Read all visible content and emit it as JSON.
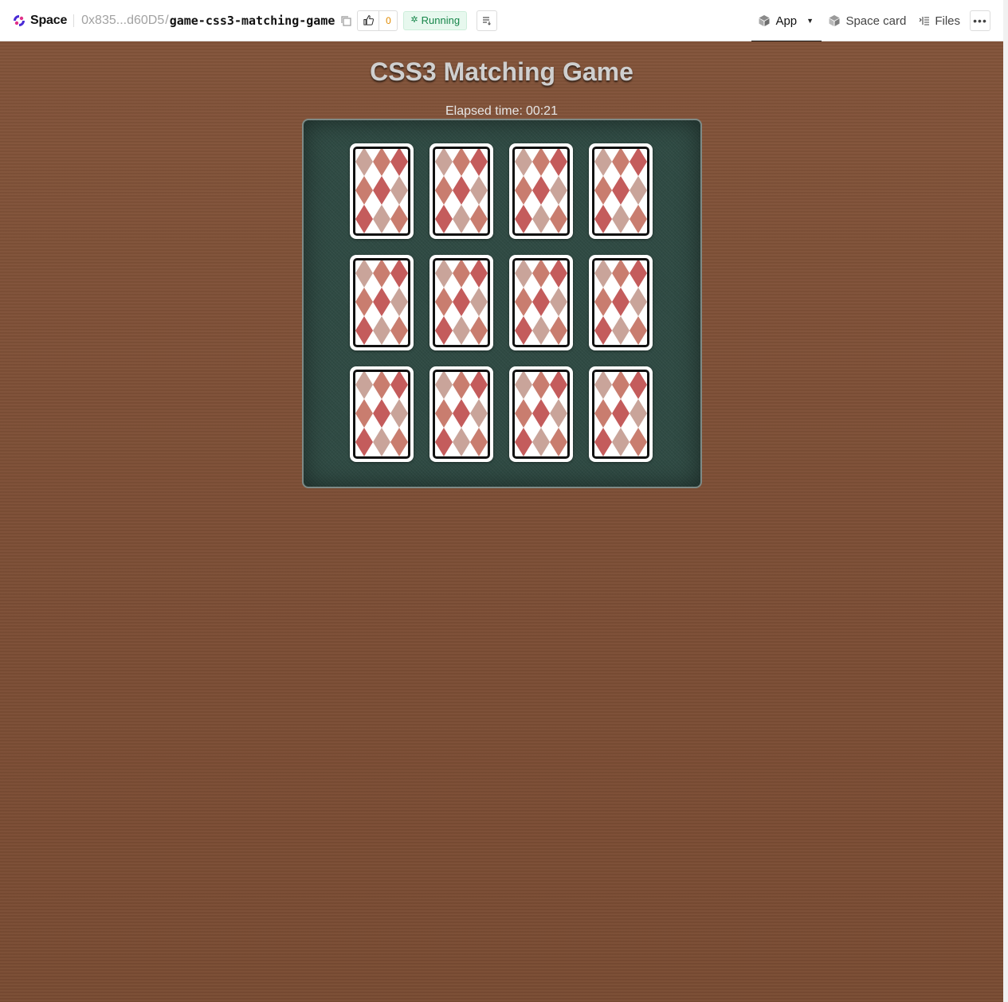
{
  "header": {
    "brand": "Space",
    "owner": "0x835...d60D5",
    "slash": "/",
    "repo": "game-css3-matching-game",
    "likes": "0",
    "status": "Running",
    "tabs": {
      "app": "App",
      "space_card": "Space card",
      "files": "Files"
    },
    "icons": {
      "brand": "space-logo-icon",
      "copy": "copy-icon",
      "like": "thumbs-up-icon",
      "status": "running-icon",
      "logs": "logs-icon",
      "app": "cube-icon",
      "space_card": "cube-icon",
      "files": "files-icon",
      "more": "more-icon"
    }
  },
  "game": {
    "title": "CSS3 Matching Game",
    "timer_label": "Elapsed time:",
    "timer_value": "00:21",
    "grid": {
      "rows": 3,
      "columns": 4
    },
    "cards": [
      {
        "face": "down"
      },
      {
        "face": "down"
      },
      {
        "face": "down"
      },
      {
        "face": "down"
      },
      {
        "face": "down"
      },
      {
        "face": "down"
      },
      {
        "face": "down"
      },
      {
        "face": "down"
      },
      {
        "face": "down"
      },
      {
        "face": "down"
      },
      {
        "face": "down"
      },
      {
        "face": "down"
      }
    ]
  },
  "colors": {
    "table_wood": "#7d4f36",
    "felt": "#2f4a43",
    "diamond_dark": "#c45c5c",
    "diamond_mid": "#c97d6f",
    "diamond_light": "#c9a49a",
    "status_green": "#17864a"
  }
}
